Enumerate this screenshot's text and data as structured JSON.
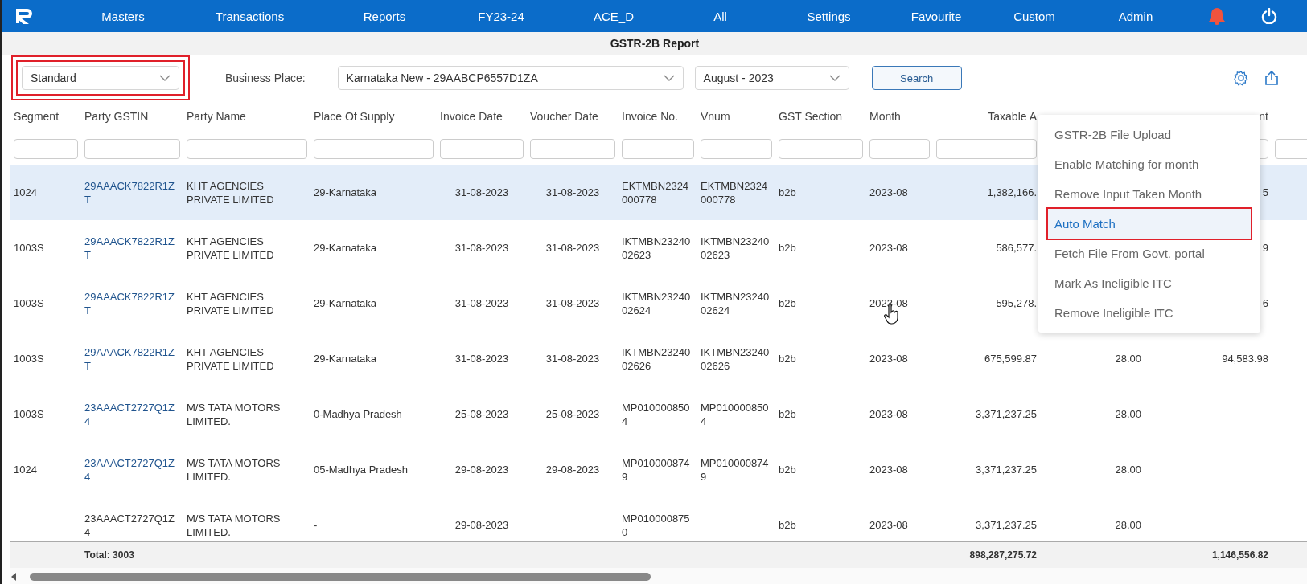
{
  "nav": {
    "items": [
      "Masters",
      "Transactions",
      "Reports",
      "FY23-24",
      "ACE_D",
      "All",
      "Settings",
      "Favourite",
      "Custom",
      "Admin"
    ]
  },
  "title": "GSTR-2B Report",
  "toolbar": {
    "view": {
      "value": "Standard",
      "outlined": true
    },
    "business_place_label": "Business Place:",
    "business_place": "Karnataka New - 29AABCP6557D1ZA",
    "period": "August - 2023",
    "search_button": "Search"
  },
  "table": {
    "columns": [
      "Segment",
      "Party GSTIN",
      "Party Name",
      "Place Of Supply",
      "Invoice Date",
      "Voucher Date",
      "Invoice No.",
      "Vnum",
      "GST Section",
      "Month",
      "Taxable A",
      null,
      "nt"
    ],
    "rows": [
      {
        "selected": true,
        "gstin_link": true,
        "cells": [
          "1024",
          "29AAACK7822R1ZT",
          "KHT AGENCIES PRIVATE LIMITED",
          "29-Karnataka",
          "31-08-2023",
          "31-08-2023",
          "EKTMBN2324000778",
          "EKTMBN2324000778",
          "b2b",
          "2023-08",
          "1,382,166.",
          null,
          "5"
        ]
      },
      {
        "selected": false,
        "gstin_link": true,
        "cells": [
          "1003S",
          "29AAACK7822R1ZT",
          "KHT AGENCIES PRIVATE LIMITED",
          "29-Karnataka",
          "31-08-2023",
          "31-08-2023",
          "IKTMBN2324002623",
          "IKTMBN2324002623",
          "b2b",
          "2023-08",
          "586,577.",
          null,
          "9"
        ]
      },
      {
        "selected": false,
        "gstin_link": true,
        "cells": [
          "1003S",
          "29AAACK7822R1ZT",
          "KHT AGENCIES PRIVATE LIMITED",
          "29-Karnataka",
          "31-08-2023",
          "31-08-2023",
          "IKTMBN2324002624",
          "IKTMBN2324002624",
          "b2b",
          "2023-08",
          "595,278.",
          null,
          "6"
        ]
      },
      {
        "selected": false,
        "gstin_link": true,
        "cells": [
          "1003S",
          "29AAACK7822R1ZT",
          "KHT AGENCIES PRIVATE LIMITED",
          "29-Karnataka",
          "31-08-2023",
          "31-08-2023",
          "IKTMBN2324002626",
          "IKTMBN2324002626",
          "b2b",
          "2023-08",
          "675,599.87",
          "28.00",
          "94,583.98"
        ]
      },
      {
        "selected": false,
        "gstin_link": true,
        "cells": [
          "1003S",
          "23AAACT2727Q1Z4",
          "M/S TATA MOTORS LIMITED.",
          "0-Madhya Pradesh",
          "25-08-2023",
          "25-08-2023",
          "MP0100008504",
          "MP0100008504",
          "b2b",
          "2023-08",
          "3,371,237.25",
          "28.00",
          null
        ]
      },
      {
        "selected": false,
        "gstin_link": true,
        "cells": [
          "1024",
          "23AAACT2727Q1Z4",
          "M/S TATA MOTORS LIMITED.",
          "05-Madhya Pradesh",
          "29-08-2023",
          "29-08-2023",
          "MP0100008749",
          "MP0100008749",
          "b2b",
          "2023-08",
          "3,371,237.25",
          "28.00",
          null
        ]
      },
      {
        "selected": false,
        "gstin_link": false,
        "cells": [
          null,
          "23AAACT2727Q1Z4",
          "M/S TATA MOTORS LIMITED.",
          "-",
          "29-08-2023",
          null,
          "MP0100008750",
          null,
          "b2b",
          "2023-08",
          "3,371,237.25",
          "28.00",
          null
        ]
      }
    ],
    "footer": {
      "total_count": "Total: 3003",
      "taxable_total": "898,287,275.72",
      "column_13_total": "1,146,556.82"
    }
  },
  "menu": {
    "items": [
      {
        "label": "GSTR-2B File Upload",
        "selected": false,
        "outlined": false
      },
      {
        "label": "Enable Matching for month",
        "selected": false,
        "outlined": false
      },
      {
        "label": "Remove Input Taken Month",
        "selected": false,
        "outlined": false
      },
      {
        "label": "Auto Match",
        "selected": true,
        "outlined": true
      },
      {
        "label": "Fetch File From Govt. portal",
        "selected": false,
        "outlined": false
      },
      {
        "label": "Mark As Ineligible ITC",
        "selected": false,
        "outlined": false
      },
      {
        "label": "Remove Ineligible ITC",
        "selected": false,
        "outlined": false
      }
    ]
  }
}
